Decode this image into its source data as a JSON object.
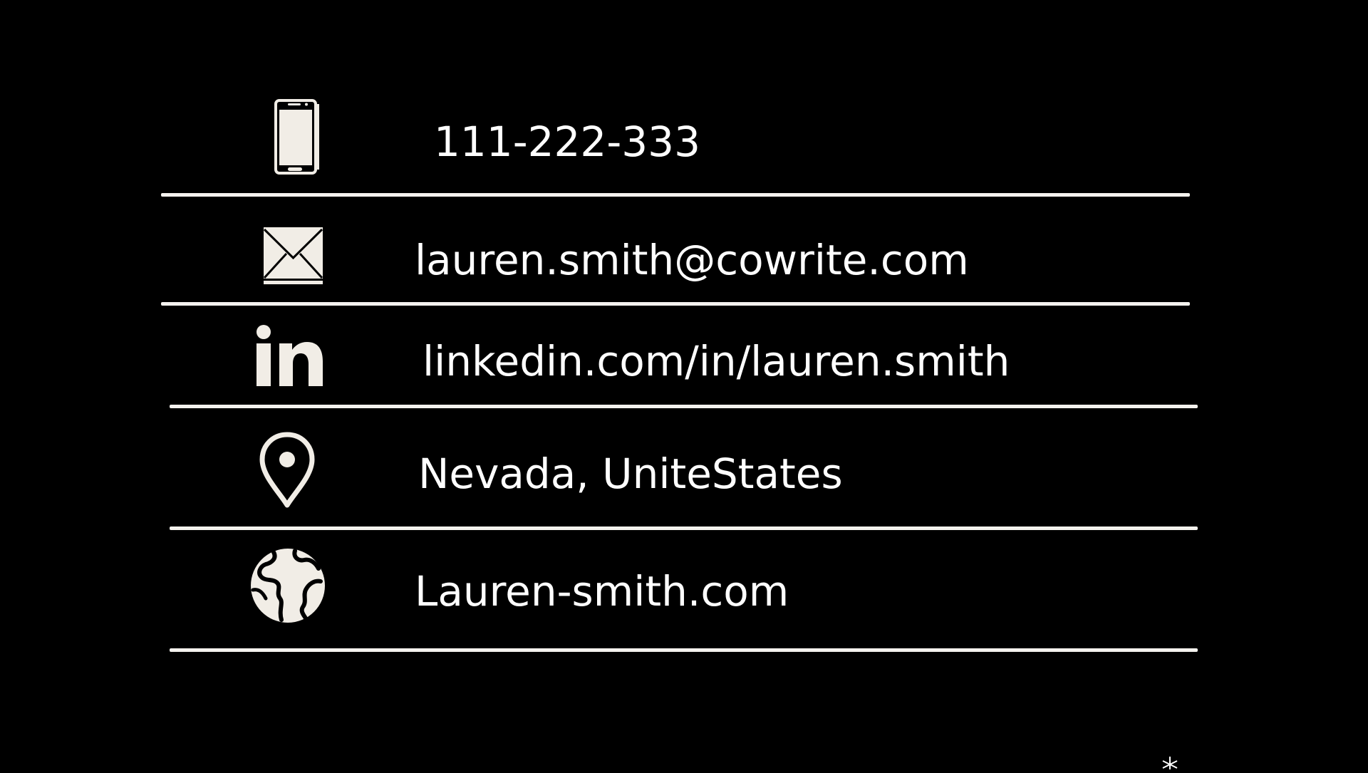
{
  "colors": {
    "background": "#000000",
    "text": "#ffffff",
    "icon": "#f1ede6",
    "divider": "#f4f2ee"
  },
  "contacts": {
    "phone": {
      "icon": "smartphone-icon",
      "text": "111-222-333"
    },
    "email": {
      "icon": "envelope-icon",
      "text": "lauren.smith@cowrite.com"
    },
    "linkedin": {
      "icon": "linkedin-icon",
      "text": "linkedin.com/in/lauren.smith"
    },
    "location": {
      "icon": "map-pin-icon",
      "text": "Nevada, UniteStates"
    },
    "website": {
      "icon": "globe-icon",
      "text": "Lauren-smith.com"
    }
  }
}
